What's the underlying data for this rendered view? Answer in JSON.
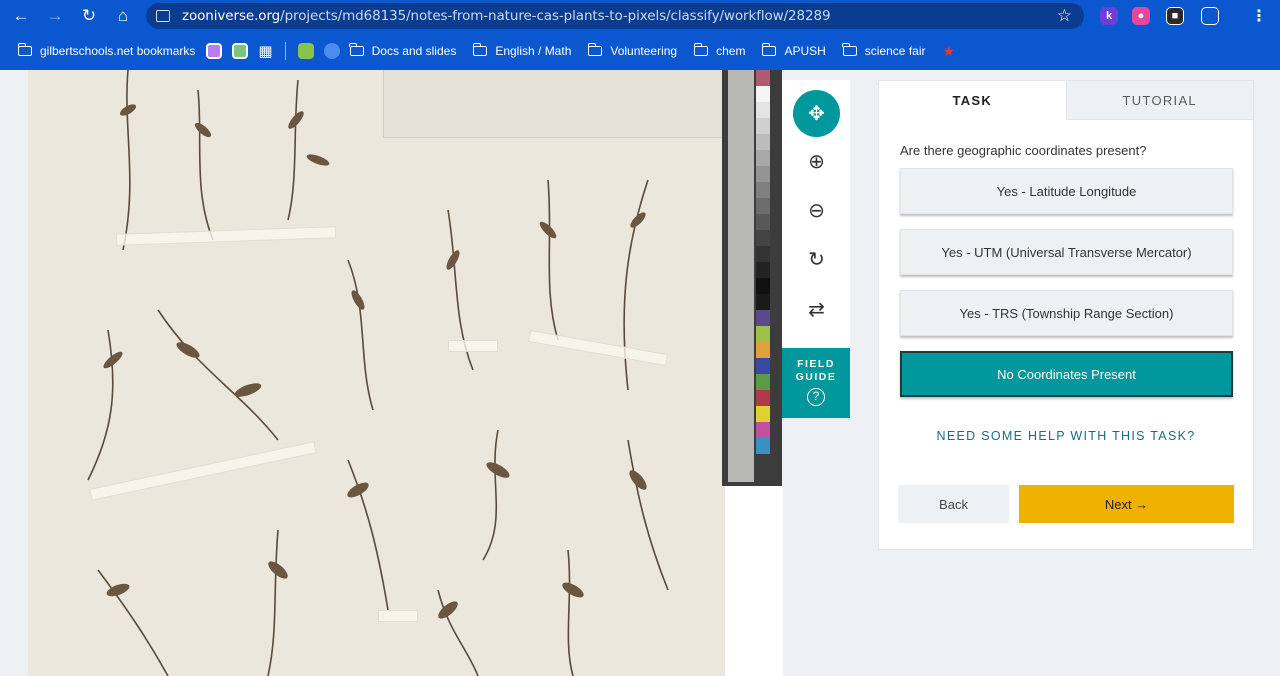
{
  "browser": {
    "url_host": "zooniverse.org",
    "url_path": "/projects/md68135/notes-from-nature-cas-plants-to-pixels/classify/workflow/28289",
    "icons": [
      "back-arrow-icon",
      "forward-arrow-icon",
      "reload-icon",
      "home-icon",
      "site-info-icon",
      "bookmark-star-icon",
      "extensions-icon",
      "menu-icon"
    ]
  },
  "bookmarks": {
    "managed_label": "gilbertschools.net bookmarks",
    "folders": [
      "Docs and slides",
      "English / Math",
      "Volunteering",
      "chem",
      "APUSH",
      "science fair"
    ]
  },
  "toolbar": {
    "field_guide_label": "FIELD GUIDE",
    "field_guide_icon": "?"
  },
  "task": {
    "tab_task": "TASK",
    "tab_tutorial": "TUTORIAL",
    "question": "Are there geographic coordinates present?",
    "answers": [
      "Yes - Latitude Longitude",
      "Yes - UTM (Universal Transverse Mercator)",
      "Yes - TRS (Township Range Section)",
      "No Coordinates Present"
    ],
    "selected_answer": "No Coordinates Present",
    "help_link": "NEED SOME HELP WITH THIS TASK?",
    "back_label": "Back",
    "next_label": "Next →"
  },
  "colors": {
    "chrome": "#0b57d0",
    "teal": "#00979d",
    "next_button": "#f0b200"
  }
}
